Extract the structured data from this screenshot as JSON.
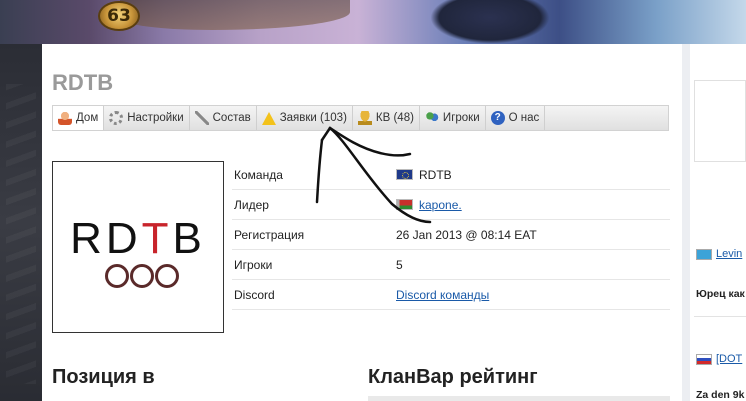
{
  "banner": {
    "level": "63"
  },
  "team": {
    "name": "RDTB"
  },
  "nav": {
    "tabs": [
      {
        "label": "Дом",
        "icon": "home-icon"
      },
      {
        "label": "Настройки",
        "icon": "gear-icon"
      },
      {
        "label": "Состав",
        "icon": "tools-icon"
      },
      {
        "label": "Заявки (103)",
        "icon": "warning-icon"
      },
      {
        "label": "КВ (48)",
        "icon": "trophy-icon"
      },
      {
        "label": "Игроки",
        "icon": "users-icon"
      },
      {
        "label": "О нас",
        "icon": "help-icon"
      }
    ]
  },
  "logo": {
    "text_a": "RD",
    "text_b": "T",
    "text_c": "B"
  },
  "info": {
    "team_label": "Команда",
    "team_value": "RDTB",
    "team_flag": "eu-flag-icon",
    "leader_label": "Лидер",
    "leader_value": "kapone.",
    "leader_flag": "belarus-flag-icon",
    "reg_label": "Регистрация",
    "reg_value": "26 Jan 2013 @ 08:14 EAT",
    "players_label": "Игроки",
    "players_value": "5",
    "discord_label": "Discord",
    "discord_value": "Discord команды"
  },
  "sections": {
    "position": "Позиция в",
    "clanwar": "КланВар рейтинг"
  },
  "sidebar": {
    "row1_link": "Levin",
    "row2_text": "Юрец как",
    "row3_link": "[DOT",
    "row4_text": "Za den 9k"
  },
  "colors": {
    "link": "#1a5aa8",
    "title_gray": "#9a9a9a",
    "logo_red": "#c8242b"
  }
}
